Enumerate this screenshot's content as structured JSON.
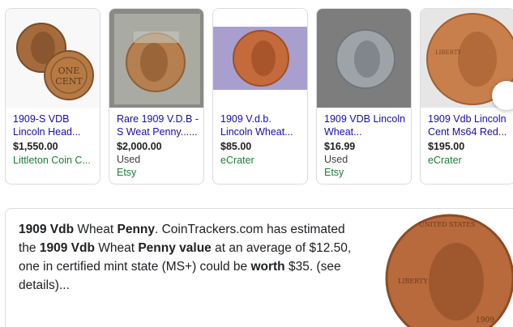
{
  "shopping_results": [
    {
      "title": "1909-S VDB Lincoln Head...",
      "price": "$1,550.00",
      "condition": "",
      "seller": "Littleton Coin C..."
    },
    {
      "title": "Rare 1909 V.D.B - S Weat Penny......",
      "price": "$2,000.00",
      "condition": "Used",
      "seller": "Etsy"
    },
    {
      "title": "1909 V.d.b. Lincoln Wheat...",
      "price": "$85.00",
      "condition": "",
      "seller": "eCrater"
    },
    {
      "title": "1909 VDB Lincoln Wheat...",
      "price": "$16.99",
      "condition": "Used",
      "seller": "Etsy"
    },
    {
      "title": "1909 Vdb Lincoln Cent Ms64 Red...",
      "price": "$195.00",
      "condition": "",
      "seller": "eCrater"
    }
  ],
  "snippet": {
    "segments": [
      {
        "text": "1909 Vdb",
        "bold": true
      },
      {
        "text": " Wheat ",
        "bold": false
      },
      {
        "text": "Penny",
        "bold": true
      },
      {
        "text": ". CoinTrackers.com has estimated the ",
        "bold": false
      },
      {
        "text": "1909 Vdb",
        "bold": true
      },
      {
        "text": " Wheat ",
        "bold": false
      },
      {
        "text": "Penny value",
        "bold": true
      },
      {
        "text": " at an average of $12.50, one in certified mint state (MS+) could be ",
        "bold": false
      },
      {
        "text": "worth",
        "bold": true
      },
      {
        "text": " $35. (see details)...",
        "bold": false
      }
    ]
  },
  "coin_texts": {
    "one_cent": [
      "ONE",
      "CENT"
    ],
    "united_states": "UNITED STATES",
    "liberty": "LIBERTY",
    "year": "1909"
  },
  "colors": {
    "link": "#1a0dab",
    "seller": "#188038",
    "copper": "#b86a3c",
    "border": "#dadce0"
  }
}
